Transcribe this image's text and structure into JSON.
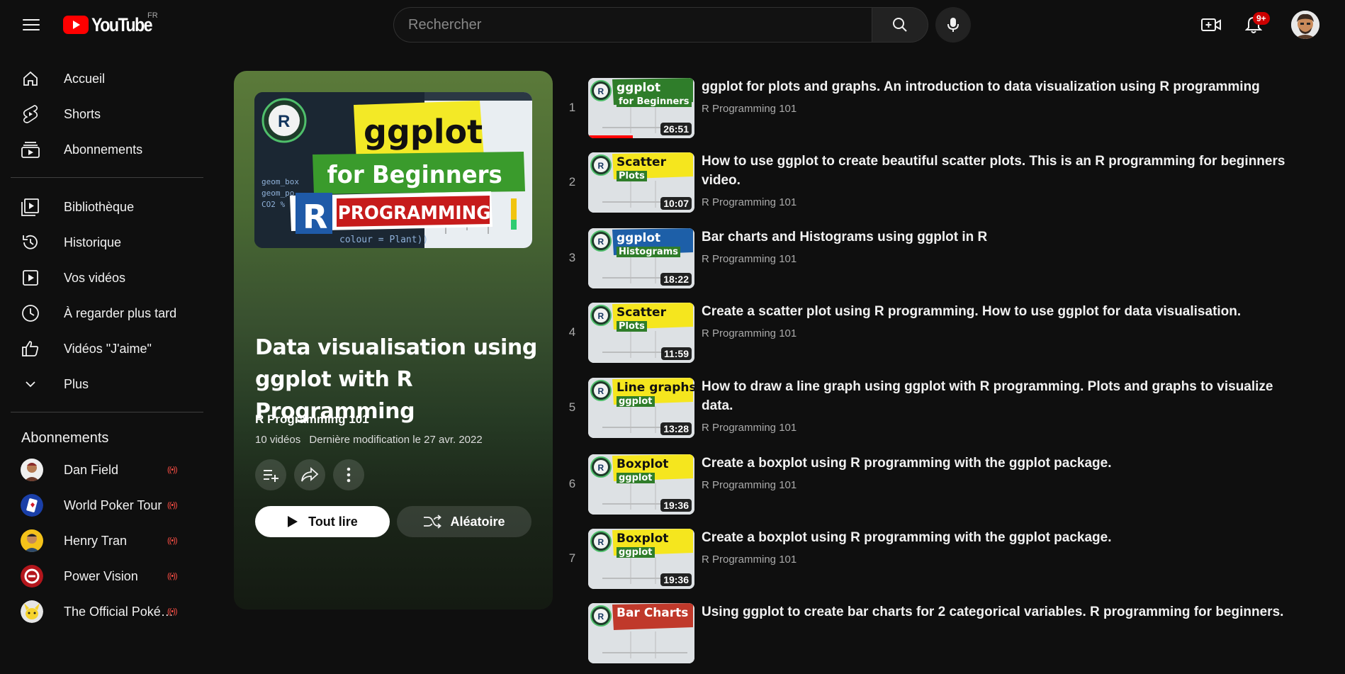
{
  "header": {
    "logo_text": "YouTube",
    "country_code": "FR",
    "search_placeholder": "Rechercher",
    "notification_count": "9+"
  },
  "sidebar": {
    "main": [
      {
        "label": "Accueil",
        "icon": "home-icon"
      },
      {
        "label": "Shorts",
        "icon": "shorts-icon"
      },
      {
        "label": "Abonnements",
        "icon": "subscriptions-icon"
      }
    ],
    "library": [
      {
        "label": "Bibliothèque",
        "icon": "library-icon"
      },
      {
        "label": "Historique",
        "icon": "history-icon"
      },
      {
        "label": "Vos vidéos",
        "icon": "your-videos-icon"
      },
      {
        "label": "À regarder plus tard",
        "icon": "watch-later-icon"
      },
      {
        "label": "Vidéos \"J'aime\"",
        "icon": "like-icon"
      },
      {
        "label": "Plus",
        "icon": "chevron-down-icon"
      }
    ],
    "subscriptions_heading": "Abonnements",
    "subscriptions": [
      {
        "name": "Dan Field",
        "live": "((•))"
      },
      {
        "name": "World Poker Tour",
        "live": "((•))"
      },
      {
        "name": "Henry Tran",
        "live": "((•))"
      },
      {
        "name": "Power Vision",
        "live": "((•))"
      },
      {
        "name": "The Official Poké…",
        "live": "((•))"
      }
    ]
  },
  "playlist": {
    "thumb_text_1": "ggplot",
    "thumb_text_2": "for Beginners",
    "thumb_text_3": "R",
    "thumb_text_4": "PROGRAMMING",
    "title": "Data visualisation using ggplot with R Programming",
    "channel": "R Programming 101",
    "video_count": "10 vidéos",
    "last_modified": "Dernière modification le 27 avr. 2022",
    "play_all_label": "Tout lire",
    "shuffle_label": "Aléatoire"
  },
  "videos": [
    {
      "index": "1",
      "title": "ggplot for plots and graphs. An introduction to data visualization using R programming",
      "channel": "R Programming 101",
      "duration": "26:51",
      "thumb_a": "ggplot",
      "thumb_b": "for Beginners",
      "thumb_bg": "#2f7d2a",
      "watched_fraction": 0.42
    },
    {
      "index": "2",
      "title": "How to use ggplot to create beautiful scatter plots. This is an R programming for beginners video.",
      "channel": "R Programming 101",
      "duration": "10:07",
      "thumb_a": "Scatter",
      "thumb_b": "Plots",
      "thumb_bg": "#f5e61e"
    },
    {
      "index": "3",
      "title": "Bar charts and Histograms using ggplot in R",
      "channel": "R Programming 101",
      "duration": "18:22",
      "thumb_a": "ggplot",
      "thumb_b": "Histograms",
      "thumb_bg": "#1d5fa8"
    },
    {
      "index": "4",
      "title": "Create a scatter plot using R programming. How to use ggplot for data visualisation.",
      "channel": "R Programming 101",
      "duration": "11:59",
      "thumb_a": "Scatter",
      "thumb_b": "Plots",
      "thumb_bg": "#f5e61e"
    },
    {
      "index": "5",
      "title": "How to draw a line graph using ggplot with R programming. Plots and graphs to visualize data.",
      "channel": "R Programming 101",
      "duration": "13:28",
      "thumb_a": "Line graphs",
      "thumb_b": "ggplot",
      "thumb_bg": "#f5e61e"
    },
    {
      "index": "6",
      "title": "Create a boxplot using R programming with the ggplot package.",
      "channel": "R Programming 101",
      "duration": "19:36",
      "thumb_a": "Boxplot",
      "thumb_b": "ggplot",
      "thumb_bg": "#f5e61e"
    },
    {
      "index": "7",
      "title": "Create a boxplot using R programming with the ggplot package.",
      "channel": "R Programming 101",
      "duration": "19:36",
      "thumb_a": "Boxplot",
      "thumb_b": "ggplot",
      "thumb_bg": "#f5e61e"
    },
    {
      "index": "",
      "title": "Using ggplot to create bar charts for 2 categorical variables. R programming for beginners.",
      "channel": "",
      "duration": "",
      "thumb_a": "Bar Charts",
      "thumb_b": "",
      "thumb_bg": "#c0392b"
    }
  ]
}
